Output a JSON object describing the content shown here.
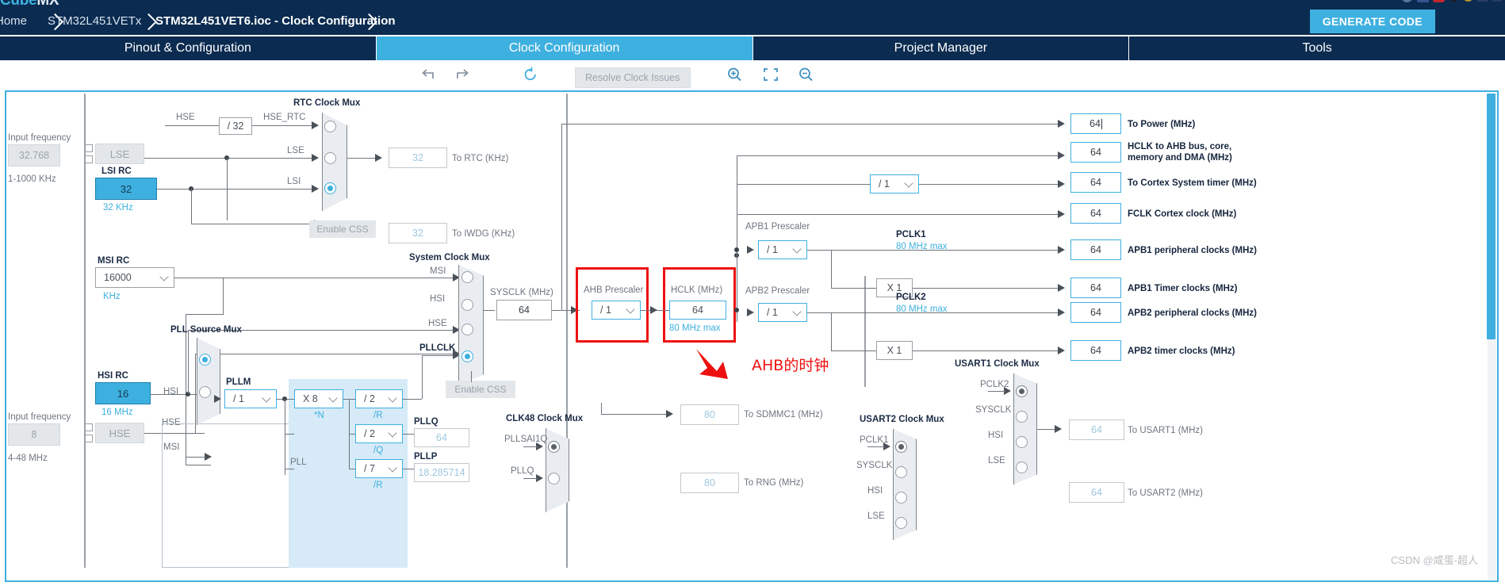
{
  "app": {
    "logo_primary": "Cube",
    "logo_secondary": "MX"
  },
  "breadcrumb": {
    "items": [
      {
        "label": "Home",
        "active": false
      },
      {
        "label": "STM32L451VETx",
        "active": false
      },
      {
        "label": "STM32L451VET6.ioc - Clock Configuration",
        "active": true
      }
    ]
  },
  "header": {
    "generate_code_label": "GENERATE CODE"
  },
  "tabs": [
    {
      "label": "Pinout & Configuration",
      "selected": false
    },
    {
      "label": "Clock Configuration",
      "selected": true
    },
    {
      "label": "Project Manager",
      "selected": false
    },
    {
      "label": "Tools",
      "selected": false
    }
  ],
  "toolbar": {
    "undo_icon": "undo-icon",
    "redo_icon": "redo-icon",
    "refresh_icon": "refresh-icon",
    "resolve_label": "Resolve Clock Issues",
    "zoom_in_icon": "zoom-in-icon",
    "fit_icon": "fit-to-screen-icon",
    "zoom_out_icon": "zoom-out-icon"
  },
  "clock_tree": {
    "lse": {
      "input_frequency_label": "Input frequency",
      "input_frequency_value": "32.768",
      "range": "1-1000 KHz",
      "source_label": "LSE"
    },
    "lsi": {
      "title": "LSI RC",
      "value": "32",
      "unit": "32 KHz"
    },
    "hse_div": {
      "input_label": "HSE",
      "divider": "/ 32",
      "output_label": "HSE_RTC"
    },
    "rtc_mux": {
      "title": "RTC Clock Mux",
      "inputs": [
        "HSE_RTC",
        "LSE",
        "LSI"
      ],
      "selected_index": 2
    },
    "to_rtc": {
      "value": "32",
      "label": "To RTC (KHz)"
    },
    "to_iwdg": {
      "value": "32",
      "label": "To IWDG (KHz)"
    },
    "enable_css_lse": "Enable CSS",
    "msi": {
      "title": "MSI RC",
      "value": "16000",
      "unit": "KHz"
    },
    "hsi": {
      "title": "HSI RC",
      "value": "16",
      "unit": "16 MHz"
    },
    "hse": {
      "input_frequency_label": "Input frequency",
      "input_frequency_value": "8",
      "range": "4-48 MHz",
      "source_label": "HSE"
    },
    "pll_source_mux": {
      "title": "PLL Source Mux",
      "inputs": [
        "MSI",
        "HSI",
        "HSE"
      ],
      "selected_index": 0
    },
    "pll": {
      "pllm_label": "PLLM",
      "pllm_value": "/ 1",
      "plln_label": "*N",
      "plln_value": "X 8",
      "pllr_label": "/R",
      "pllr_value": "/ 2",
      "pllq_label": "/Q",
      "pllq_value": "/ 2",
      "pllq_out_label": "PLLQ",
      "pllq_out_value": "64",
      "pllp_label": "/R",
      "pllp_value": "/ 7",
      "pllp_out_label": "PLLP",
      "pllp_out_value": "18.285714",
      "pll_label": "PLL"
    },
    "system_clock_mux": {
      "title": "System Clock Mux",
      "inputs": [
        "MSI",
        "HSI",
        "HSE",
        "PLLCLK"
      ],
      "selected_index": 3
    },
    "enable_css_sys": "Enable CSS",
    "sysclk": {
      "label": "SYSCLK (MHz)",
      "value": "64"
    },
    "ahb_prescaler": {
      "title": "AHB Prescaler",
      "value": "/ 1"
    },
    "hclk": {
      "title": "HCLK (MHz)",
      "value": "64",
      "max": "80 MHz max"
    },
    "cortex_prescaler": {
      "value": "/ 1"
    },
    "apb1_prescaler": {
      "title": "APB1 Prescaler",
      "value": "/ 1"
    },
    "apb2_prescaler": {
      "title": "APB2 Prescaler",
      "value": "/ 1"
    },
    "pclk1": {
      "label": "PCLK1",
      "max": "80 MHz max",
      "mult": "X 1"
    },
    "pclk2": {
      "label": "PCLK2",
      "max": "80 MHz max",
      "mult": "X 1"
    },
    "outputs": [
      {
        "value": "64",
        "label": "To Power (MHz)",
        "caret": true
      },
      {
        "value": "64",
        "label": "HCLK to AHB bus, core,\nmemory and DMA (MHz)",
        "caret": false
      },
      {
        "value": "64",
        "label": "To Cortex System timer (MHz)",
        "caret": false
      },
      {
        "value": "64",
        "label": "FCLK Cortex clock (MHz)",
        "caret": false
      },
      {
        "value": "64",
        "label": "APB1 peripheral clocks (MHz)",
        "caret": false
      },
      {
        "value": "64",
        "label": "APB1 Timer clocks (MHz)",
        "caret": false
      },
      {
        "value": "64",
        "label": "APB2 peripheral clocks (MHz)",
        "caret": false
      },
      {
        "value": "64",
        "label": "APB2 timer clocks (MHz)",
        "caret": false
      }
    ],
    "clk48_mux": {
      "title": "CLK48 Clock Mux",
      "inputs": [
        "PLLSAI1Q",
        "PLLQ"
      ]
    },
    "sdmmc1": {
      "value": "80",
      "label": "To SDMMC1 (MHz)"
    },
    "rng": {
      "value": "80",
      "label": "To RNG (MHz)"
    },
    "usart2_mux": {
      "title": "USART2 Clock Mux",
      "inputs": [
        "PCLK1",
        "SYSCLK",
        "HSI",
        "LSE"
      ]
    },
    "usart1_mux": {
      "title": "USART1 Clock Mux",
      "inputs": [
        "PCLK2",
        "SYSCLK",
        "HSI",
        "LSE"
      ]
    },
    "to_usart1": {
      "value": "64",
      "label": "To USART1 (MHz)"
    },
    "to_usart2": {
      "value": "64",
      "label": "To USART2 (MHz)"
    }
  },
  "annotation": {
    "text": "AHB的时钟",
    "color": "#ee1111"
  },
  "watermark": {
    "text": "CSDN @咸蛋-超人"
  },
  "colors": {
    "navy": "#0b2b50",
    "accent": "#3eb0e0",
    "red": "#ee1111"
  }
}
